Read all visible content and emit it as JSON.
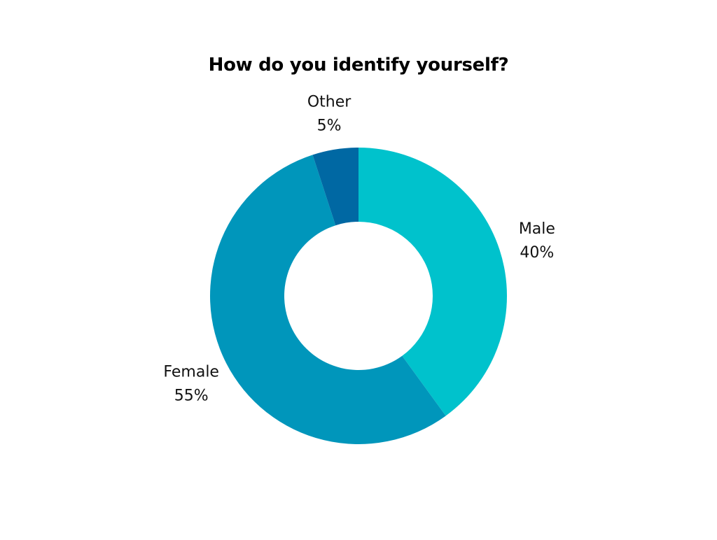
{
  "chart_data": {
    "type": "pie",
    "variant": "donut",
    "title": "How do you identify yourself?",
    "slices": [
      {
        "label": "Male",
        "value": 40,
        "value_label": "40%",
        "color": "#00C2CC"
      },
      {
        "label": "Female",
        "value": 55,
        "value_label": "55%",
        "color": "#0096BB"
      },
      {
        "label": "Other",
        "value": 5,
        "value_label": "5%",
        "color": "#0068A3"
      }
    ],
    "start": "top",
    "direction": "clockwise",
    "legend": "none"
  }
}
